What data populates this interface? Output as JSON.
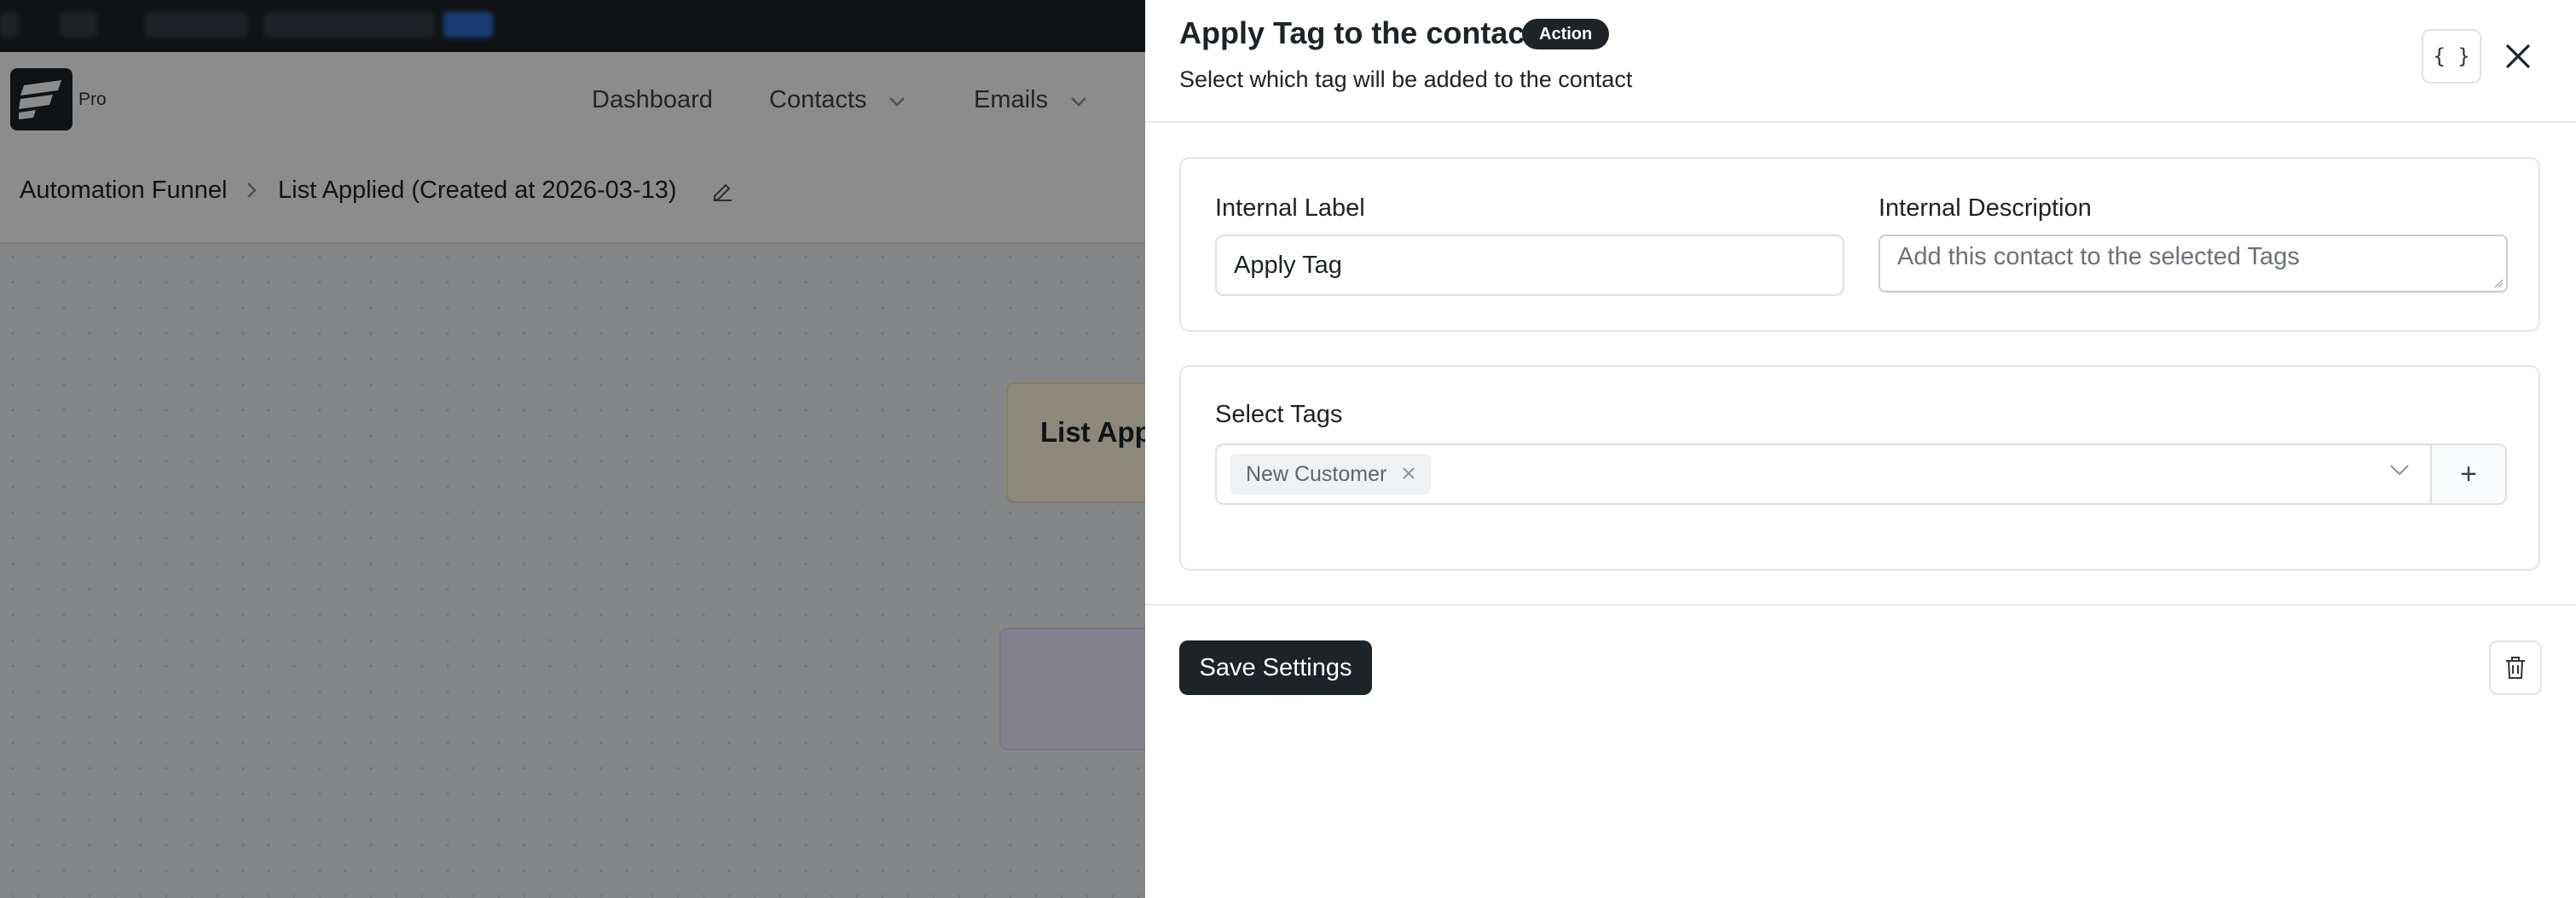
{
  "app": {
    "logo_badge": "Pro",
    "nav": [
      {
        "label": "Dashboard"
      },
      {
        "label": "Contacts"
      },
      {
        "label": "Emails"
      }
    ]
  },
  "breadcrumb": {
    "root": "Automation Funnel",
    "current": "List Applied (Created at 2026-03-13)"
  },
  "canvas": {
    "trigger_node_label": "List App"
  },
  "drawer": {
    "title": "Apply Tag to the contact",
    "badge": "Action",
    "subtitle": "Select which tag will be added to the contact",
    "code_button": "{ }",
    "internal_label": {
      "label": "Internal Label",
      "value": "Apply Tag"
    },
    "internal_description": {
      "label": "Internal Description",
      "placeholder": "Add this contact to the selected Tags"
    },
    "select_tags": {
      "label": "Select Tags",
      "selected": [
        "New Customer"
      ],
      "add_button": "+"
    },
    "save_button": "Save Settings"
  }
}
